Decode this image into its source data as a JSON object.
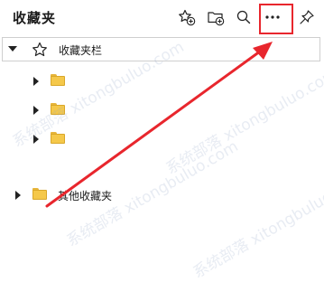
{
  "header": {
    "title": "收藏夹",
    "tools": [
      {
        "name": "add-favorite",
        "icon": "star-plus-icon"
      },
      {
        "name": "add-folder",
        "icon": "folder-plus-icon"
      },
      {
        "name": "search",
        "icon": "search-icon"
      },
      {
        "name": "more",
        "icon": "more-icon",
        "label": "···"
      },
      {
        "name": "pin",
        "icon": "pin-icon"
      }
    ]
  },
  "favorites_bar": {
    "label": "收藏夹栏",
    "expanded": true
  },
  "tree": {
    "folders": [
      {
        "label": ""
      },
      {
        "label": ""
      },
      {
        "label": ""
      }
    ],
    "other": {
      "label": "其他收藏夹"
    }
  },
  "annotation": {
    "highlight_color": "#e8262d",
    "target": "more-button"
  },
  "watermark": {
    "text": "系统部落 xitongbuluo.com"
  }
}
